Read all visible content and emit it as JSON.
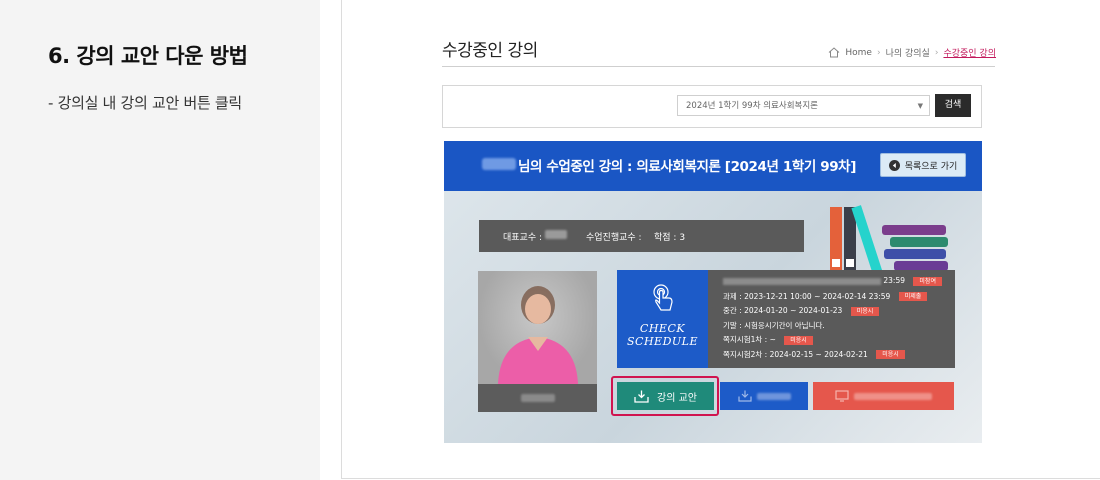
{
  "guide": {
    "title": "6. 강의 교안 다운 방법",
    "description": "- 강의실 내 강의 교안 버튼 클릭"
  },
  "page": {
    "heading": "수강중인 강의",
    "breadcrumb": [
      "Home",
      "나의 강의실",
      "수강중인 강의"
    ]
  },
  "search": {
    "selected_term": "2024년 1학기 99차 의료사회복지론",
    "button_label": "검색"
  },
  "banner": {
    "title": "님의 수업중인 강의 : 의료사회복지론 [2024년 1학기 99차]",
    "back_label": "목록으로 가기",
    "info": {
      "professor_label": "대표교수 :",
      "assistant_label": "수업진행교수 :",
      "credit": "학점 : 3"
    }
  },
  "schedule": {
    "check_label_1": "CHECK",
    "check_label_2": "SCHEDULE",
    "rows": [
      {
        "text": "23:59",
        "badge": "미참여"
      },
      {
        "text": "과제 : 2023-12-21 10:00 ~ 2024-02-14 23:59",
        "badge": "미제출"
      },
      {
        "text": "중간 : 2024-01-20 ~ 2024-01-23",
        "badge": "미응시"
      },
      {
        "text": "기말 : 시험응시기간이 아닙니다.",
        "badge": ""
      },
      {
        "text": "쪽지시험1차 : ~",
        "badge": "미응시"
      },
      {
        "text": "쪽지시험2차 : 2024-02-15 ~ 2024-02-21",
        "badge": "미응시"
      }
    ]
  },
  "actions": {
    "lesson_material_label": "강의 교안"
  },
  "colors": {
    "banner_blue": "#1a56c4",
    "lesson_green": "#1f8a7a",
    "highlight": "#d0144f",
    "badge_red": "#e5574c"
  }
}
